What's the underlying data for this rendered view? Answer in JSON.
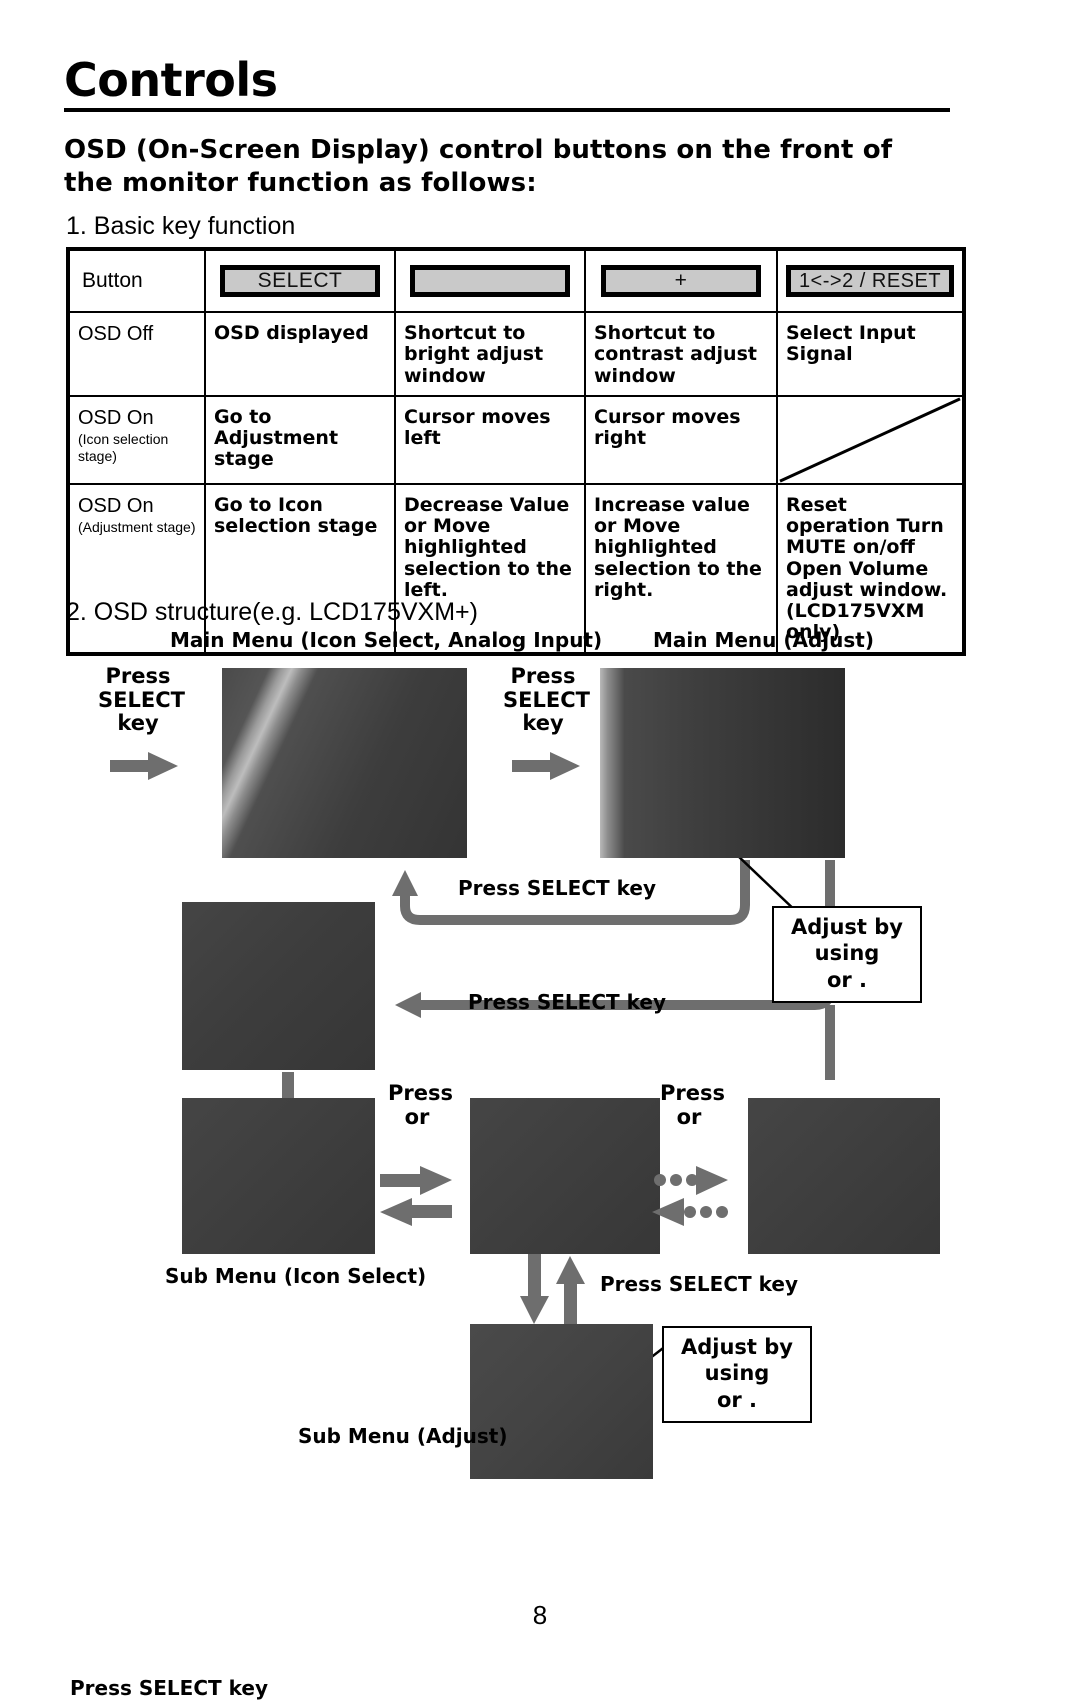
{
  "document": {
    "title": "Controls",
    "intro": "OSD (On-Screen Display) control buttons on the front of the monitor function as follows:",
    "section_1_heading": "1. Basic key function",
    "section_2_heading": "2. OSD structure(e.g. LCD175VXM+)",
    "page_number": "8"
  },
  "table": {
    "header": {
      "row_label": "Button",
      "buttons": [
        {
          "label": "SELECT",
          "name": "select"
        },
        {
          "label": "",
          "name": "minus"
        },
        {
          "label": "+",
          "name": "plus"
        },
        {
          "label": "1<->2 / RESET",
          "name": "reset"
        }
      ]
    },
    "rows": [
      {
        "state": "OSD Off",
        "state_sub": "",
        "cells": [
          "OSD displayed",
          "Shortcut to bright adjust window",
          "Shortcut to contrast adjust window",
          "Select Input Signal"
        ]
      },
      {
        "state": "OSD On",
        "state_sub": "(Icon selection stage)",
        "cells": [
          "Go to Adjustment stage",
          "Cursor moves left",
          "Cursor moves right",
          ""
        ]
      },
      {
        "state": "OSD On",
        "state_sub": "(Adjustment stage)",
        "cells": [
          "Go to Icon selection stage",
          "Decrease Value or Move highlighted selection to the left.",
          "Increase value or Move highlighted selection to the right.",
          "Reset operation Turn MUTE on/off Open Volume adjust window. (LCD175VXM only)"
        ]
      }
    ]
  },
  "diagram": {
    "captions": {
      "main_menu_icon_select": "Main Menu (Icon Select, Analog Input)",
      "main_menu_adjust": "Main Menu (Adjust)",
      "sub_menu_icon_select": "Sub Menu (Icon Select)",
      "sub_menu_adjust": "Sub Menu (Adjust)"
    },
    "labels": {
      "press_select_key_multiline": "Press\nSELECT\nkey",
      "press_select_key": "Press SELECT key",
      "press_or": "Press\nor"
    },
    "callouts": {
      "adjust_by_using": "Adjust by using\nor  ."
    },
    "colors": {
      "arrow": "#6e6e6e",
      "screen_dark": "#3c3c3c",
      "button_fill": "#c9c9c9"
    }
  }
}
